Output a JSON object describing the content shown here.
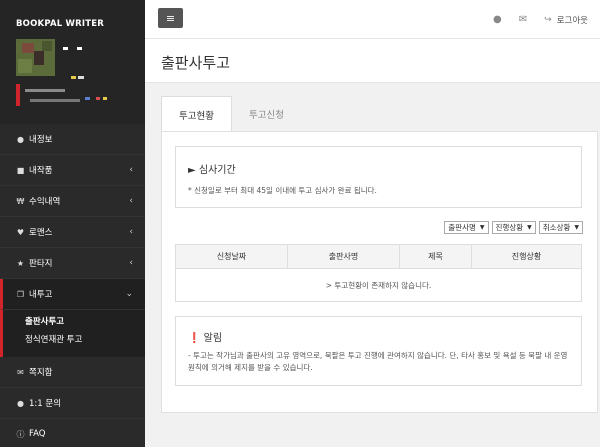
{
  "sidebar": {
    "brand": "BOOKPAL WRITER",
    "menu": {
      "naejeongbo": {
        "icon": "user-icon",
        "label": "내정보"
      },
      "jakpum": {
        "icon": "book-icon",
        "label": "내작품"
      },
      "suik": {
        "icon": "won-icon",
        "label": "수익내역"
      },
      "romance": {
        "icon": "heart-icon",
        "label": "로맨스"
      },
      "fantasy": {
        "icon": "star-icon",
        "label": "판타지"
      },
      "tugo": {
        "icon": "copy-icon",
        "label": "내투고"
      },
      "jjokji": {
        "icon": "envelope-icon",
        "label": "쪽지함"
      },
      "inquiry": {
        "icon": "comments-icon",
        "label": "1:1 문의"
      },
      "faq": {
        "icon": "info-icon",
        "label": "FAQ"
      }
    },
    "submenu": {
      "publisher": "출판사투고",
      "serial": "정식연재관 투고"
    }
  },
  "topbar": {
    "menu_icon": "hamburger-icon",
    "user_icon": "user-icon",
    "mail_icon": "envelope-icon",
    "logout": {
      "icon": "sign-out-icon",
      "label": "로그아웃"
    }
  },
  "page": {
    "title": "출판사투고"
  },
  "tabs": {
    "status": "투고현황",
    "apply": "투고신청"
  },
  "period": {
    "icon": "megaphone-icon",
    "title": "심사기간",
    "desc": "* 신청일로 부터 최대 45일 이내에 투고 심사가 완료 됩니다."
  },
  "filters": {
    "publisher": "출판사명",
    "progress": "진행상황",
    "cancel": "취소상황"
  },
  "table": {
    "headers": [
      "신청날짜",
      "출판사명",
      "제목",
      "진행상황"
    ],
    "empty": "> 투고현황이 존재하지 않습니다."
  },
  "notice": {
    "icon": "exclamation-circle-icon",
    "title": "알림",
    "desc": "- 투고는 작가님과 출판사의 고유 영역으로, 북팔은 투고 진행에 관여하지 않습니다. 단, 타사 홍보 및 욕설 등 북팔 내 운영 원칙에 의거해 제지를 받을 수 있습니다."
  },
  "colors": {
    "sidebar_bg": "#2a2a2a",
    "accent_red": "#d0252b",
    "page_bg": "#f1f1f1"
  }
}
